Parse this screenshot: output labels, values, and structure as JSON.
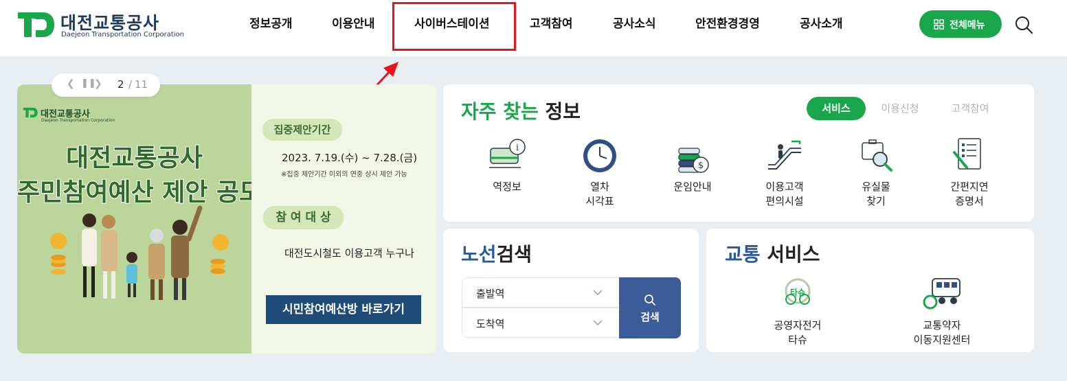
{
  "header": {
    "logo": {
      "name": "대전교통공사",
      "subtitle": "Daejeon Transportation Corporation"
    },
    "nav": [
      {
        "label": "정보공개"
      },
      {
        "label": "이용안내"
      },
      {
        "label": "사이버스테이션"
      },
      {
        "label": "고객참여"
      },
      {
        "label": "공사소식"
      },
      {
        "label": "안전환경경영"
      },
      {
        "label": "공사소개"
      }
    ],
    "all_menu_label": "전체메뉴",
    "search_icon": "search-icon",
    "accent_color": "#1aa64a",
    "highlight_color": "#e8141b"
  },
  "banner": {
    "pager": {
      "current": "2",
      "separator": "/",
      "total": "11",
      "prev_icon": "chevron-left-icon",
      "pause_icon": "pause-icon",
      "next_icon": "chevron-right-icon"
    },
    "logo_name": "대전교통공사",
    "logo_subtitle": "Daejeon Transportation Corporation",
    "title_line1": "대전교통공사",
    "title_line2": "주민참여예산 제안 공모",
    "period_label": "집중제안기간",
    "period": "2023. 7.19.(수) ~ 7.28.(금)",
    "period_note": "※집중 제안기간 이외의 연중 상시 제안 가능",
    "target_label": "참 여 대 상",
    "target": "대전도시철도 이용고객 누구나",
    "cta": "시민참여예산방 바로가기",
    "colors": {
      "left_bg": "#bcd59b",
      "title": "#2f6a2a",
      "cta_bg": "#1f4b79"
    }
  },
  "frequent": {
    "title_part1": "자주 찾는",
    "title_part2": "정보",
    "tabs": [
      {
        "label": "서비스",
        "active": true
      },
      {
        "label": "이용신청",
        "active": false
      },
      {
        "label": "고객참여",
        "active": false
      }
    ],
    "items": [
      {
        "line1": "역정보",
        "line2": "",
        "icon": "train-info-icon"
      },
      {
        "line1": "열차",
        "line2": "시각표",
        "icon": "clock-icon"
      },
      {
        "line1": "운임안내",
        "line2": "",
        "icon": "coins-icon"
      },
      {
        "line1": "이용고객",
        "line2": "편의시설",
        "icon": "escalator-icon"
      },
      {
        "line1": "유실물",
        "line2": "찾기",
        "icon": "lost-item-search-icon"
      },
      {
        "line1": "간편지연",
        "line2": "증명서",
        "icon": "certificate-icon"
      }
    ]
  },
  "route": {
    "title_part1": "노선",
    "title_part2": "검색",
    "departure_placeholder": "출발역",
    "arrival_placeholder": "도착역",
    "search_label": "검색",
    "button_color": "#3c5b99"
  },
  "transport": {
    "title_part1": "교통",
    "title_part2": "서비스",
    "items": [
      {
        "line1": "공영자전거",
        "line2": "타슈",
        "icon": "bicycle-tashu-icon",
        "logo_text": "타슈"
      },
      {
        "line1": "교통약자",
        "line2": "이동지원센터",
        "icon": "accessible-van-icon"
      }
    ]
  }
}
